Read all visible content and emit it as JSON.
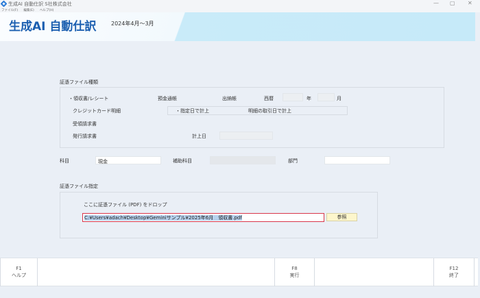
{
  "window": {
    "title": "生成AI 自動仕訳 S社株式会社",
    "controls": {
      "minimize": "—",
      "maximize": "▢",
      "close": "✕"
    }
  },
  "menu": [
    "ファイル(F)",
    "編集(E)",
    "ヘルプ(H)"
  ],
  "header": {
    "title": "生成AI 自動仕訳",
    "period": "2024年4月～3月"
  },
  "file_type": {
    "section": "証憑ファイル種類",
    "options": [
      "領収書/レシート",
      "預金通帳",
      "出納帳",
      "クレジットカード明細",
      "受領請求書",
      "発行請求書"
    ],
    "year_label": "西暦",
    "year_unit": "年",
    "month_unit": "月",
    "year_value": "",
    "month_value": "",
    "credit_options": [
      "指定日で計上",
      "明細の取引日で計上"
    ],
    "post_date_label": "計上日",
    "post_date_value": ""
  },
  "accounts": {
    "subject_label": "科目",
    "subject_value": "現金",
    "sub_label": "補助科目",
    "sub_value": "",
    "dept_label": "部門",
    "dept_value": ""
  },
  "file_spec": {
    "section": "証憑ファイル指定",
    "drop_hint": "ここに証憑ファイル (PDF) をドロップ",
    "path": "C:¥Users¥adach¥Desktop¥Geminiサンプル¥2025年6月　領収書.pdf",
    "browse": "参照"
  },
  "fkeys": [
    {
      "key": "F1",
      "label": "ヘルプ"
    },
    {
      "key": "F8",
      "label": "実行"
    },
    {
      "key": "F12",
      "label": "終了"
    }
  ]
}
